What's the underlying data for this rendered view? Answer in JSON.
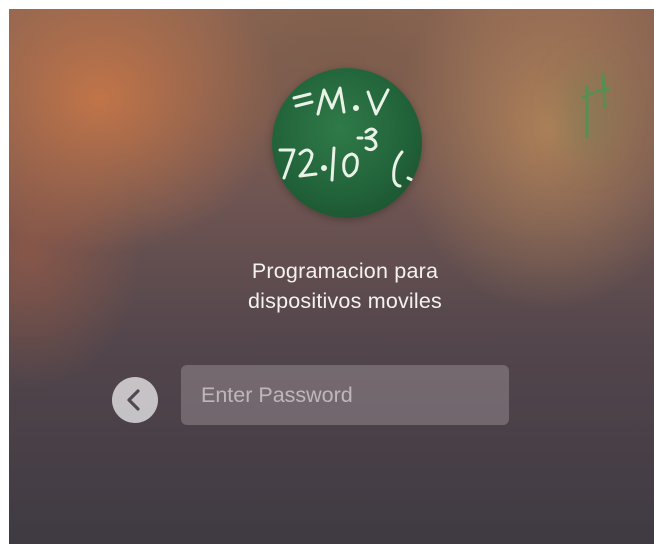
{
  "login": {
    "user_name_line1": "Programacion para",
    "user_name_line2": "dispositivos moviles",
    "password_placeholder": "Enter Password",
    "password_value": ""
  },
  "icons": {
    "avatar": "chalkboard-equation-avatar-icon",
    "back": "chevron-left-icon"
  },
  "colors": {
    "text": "#f4f1ef",
    "field_background": "rgba(175,165,172,0.38)",
    "back_button_background": "rgba(225,222,226,0.82)",
    "avatar_chalkboard": "#22633a"
  }
}
